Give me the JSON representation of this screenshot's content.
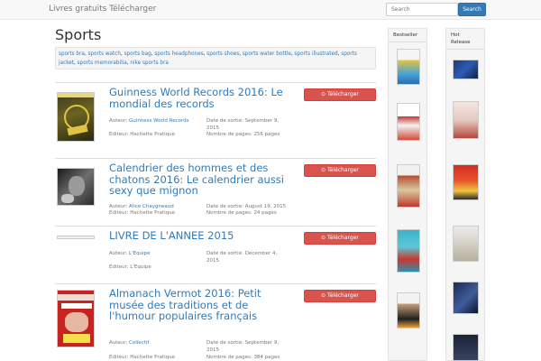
{
  "navbar": {
    "brand": "Livres gratuits Télécharger",
    "search_placeholder": "Search",
    "search_button": "Search"
  },
  "page": {
    "title": "Sports",
    "tags": [
      "sports bra",
      "sports watch",
      "sports bag",
      "sports headphones",
      "sports shoes",
      "sports water bottle",
      "sports illustrated",
      "sports jacket",
      "sports memorabilia",
      "nike sports bra"
    ]
  },
  "books": [
    {
      "title": "Guinness World Records 2016: Le mondial des records",
      "download_label": "⊙ Télécharger",
      "author_label": "Auteur:",
      "author": "Guinness World Records",
      "publisher_label": "Editeur:",
      "publisher": "Hachette Pratique",
      "release_label": "Date de sortie:",
      "release": "September 9, 2015",
      "pages_label": "Nombre de pages:",
      "pages": "256 pages"
    },
    {
      "title": "Calendrier des hommes et des chatons 2016: Le calendrier aussi sexy que mignon",
      "download_label": "⊙ Télécharger",
      "author_label": "Auteur:",
      "author": "Alice Chaygneaud",
      "publisher_label": "Editeur:",
      "publisher": "Hachette Pratique",
      "release_label": "Date de sortie:",
      "release": "August 19, 2015",
      "pages_label": "Nombre de pages:",
      "pages": "24 pages"
    },
    {
      "title": "LIVRE DE L'ANNEE 2015",
      "download_label": "⊙ Télécharger",
      "author_label": "Auteur:",
      "author": "L'Equipe",
      "publisher_label": "Editeur:",
      "publisher": "L'Equipe",
      "release_label": "Date de sortie:",
      "release": "December 4, 2015",
      "pages_label": "",
      "pages": ""
    },
    {
      "title": "Almanach Vermot 2016: Petit musée des traditions et de l'humour populaires français",
      "download_label": "⊙ Télécharger",
      "author_label": "Auteur:",
      "author": "Collectif",
      "publisher_label": "Editeur:",
      "publisher": "Hachette Pratique",
      "release_label": "Date de sortie:",
      "release": "September 9, 2015",
      "pages_label": "Nombre de pages:",
      "pages": "384 pages"
    }
  ],
  "sidebar": {
    "bestseller_label": "Bestseller",
    "hot_release_label": "Hot Release"
  }
}
